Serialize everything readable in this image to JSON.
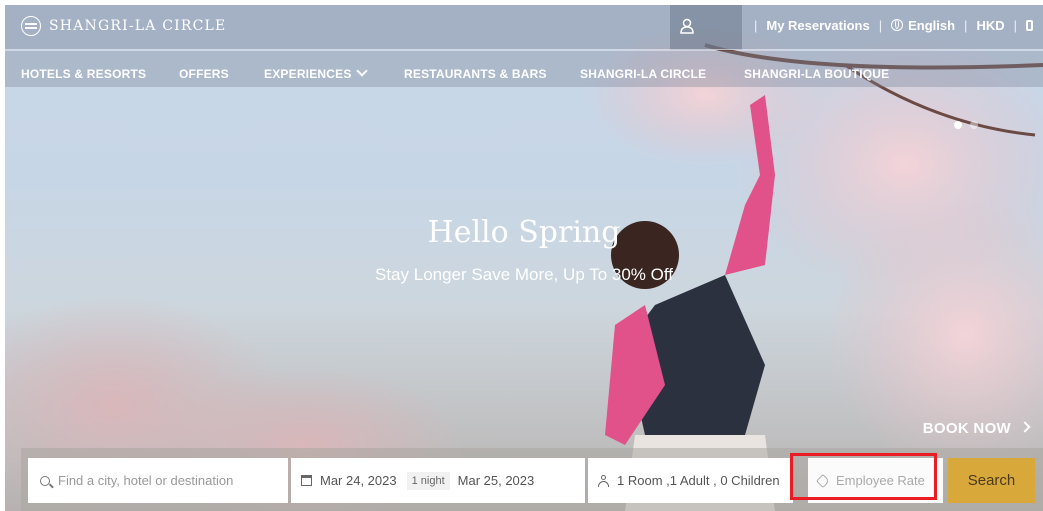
{
  "header": {
    "logo_text": "SHANGRI-LA CIRCLE",
    "my_reservations": "My Reservations",
    "language": "English",
    "currency": "HKD",
    "separator": "|"
  },
  "nav": {
    "hotels": "HOTELS & RESORTS",
    "offers": "OFFERS",
    "experiences": "EXPERIENCES",
    "restaurants": "RESTAURANTS & BARS",
    "circle": "SHANGRI-LA CIRCLE",
    "boutique": "SHANGRI-LA BOUTIQUE"
  },
  "hero": {
    "title": "Hello Spring",
    "subtitle": "Stay Longer Save More, Up To 30% Off",
    "book_now": "BOOK NOW"
  },
  "booking": {
    "destination_placeholder": "Find a city, hotel or destination",
    "check_in": "Mar 24, 2023",
    "nights": "1 night",
    "check_out": "Mar 25, 2023",
    "guests": "1 Room ,1 Adult , 0 Children",
    "rate_placeholder": "Employee Rate",
    "search_label": "Search"
  },
  "colors": {
    "search_button": "#d9a83a",
    "highlight": "#ea1c24"
  }
}
